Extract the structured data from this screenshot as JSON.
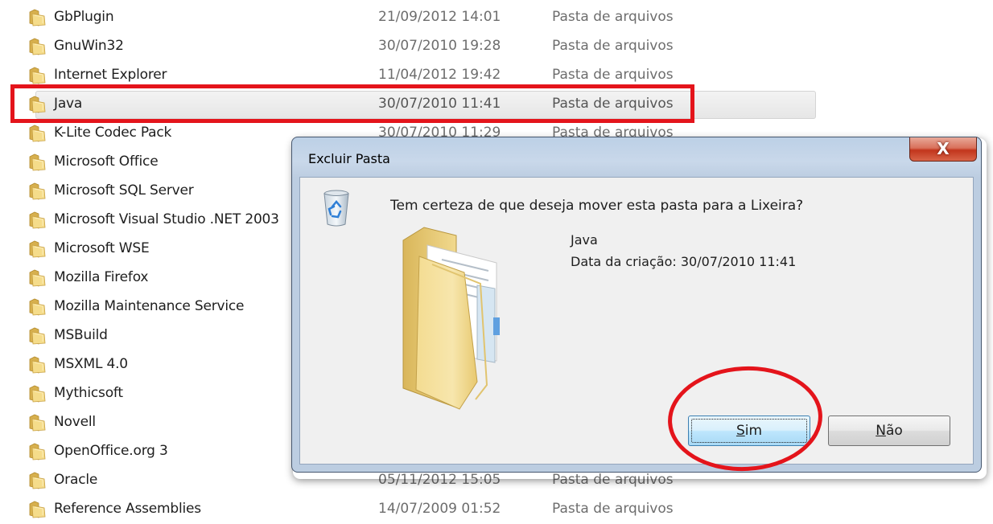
{
  "file_list": {
    "rows": [
      {
        "name": "GbPlugin",
        "date": "21/09/2012 14:01",
        "type": "Pasta de arquivos"
      },
      {
        "name": "GnuWin32",
        "date": "30/07/2010 19:28",
        "type": "Pasta de arquivos"
      },
      {
        "name": "Internet Explorer",
        "date": "11/04/2012 19:42",
        "type": "Pasta de arquivos"
      },
      {
        "name": "Java",
        "date": "30/07/2010 11:41",
        "type": "Pasta de arquivos"
      },
      {
        "name": "K-Lite Codec Pack",
        "date": "30/07/2010 11:29",
        "type": "Pasta de arquivos"
      },
      {
        "name": "Microsoft Office",
        "date": "",
        "type": ""
      },
      {
        "name": "Microsoft SQL Server",
        "date": "",
        "type": ""
      },
      {
        "name": "Microsoft Visual Studio .NET 2003",
        "date": "",
        "type": ""
      },
      {
        "name": "Microsoft WSE",
        "date": "",
        "type": ""
      },
      {
        "name": "Mozilla Firefox",
        "date": "",
        "type": ""
      },
      {
        "name": "Mozilla Maintenance Service",
        "date": "",
        "type": ""
      },
      {
        "name": "MSBuild",
        "date": "",
        "type": ""
      },
      {
        "name": "MSXML 4.0",
        "date": "",
        "type": ""
      },
      {
        "name": "Mythicsoft",
        "date": "",
        "type": ""
      },
      {
        "name": "Novell",
        "date": "",
        "type": ""
      },
      {
        "name": "OpenOffice.org 3",
        "date": "",
        "type": ""
      },
      {
        "name": "Oracle",
        "date": "05/11/2012 15:05",
        "type": "Pasta de arquivos"
      },
      {
        "name": "Reference Assemblies",
        "date": "14/07/2009 01:52",
        "type": "Pasta de arquivos"
      }
    ],
    "selected_index": 3
  },
  "dialog": {
    "title": "Excluir Pasta",
    "close_glyph": "X",
    "question": "Tem certeza de que deseja mover esta pasta para a Lixeira?",
    "item_name": "Java",
    "item_created": "Data da criação: 30/07/2010 11:41",
    "yes_label_accel": "S",
    "yes_label_rest": "im",
    "no_label_accel": "N",
    "no_label_rest": "ão",
    "icons": {
      "dialog_icon": "recycle-bin-icon",
      "item_icon": "folder-icon"
    }
  },
  "colors": {
    "annotation_red": "#e4141b",
    "close_button": "#c2351c",
    "default_button_border": "#3c7fb1"
  }
}
